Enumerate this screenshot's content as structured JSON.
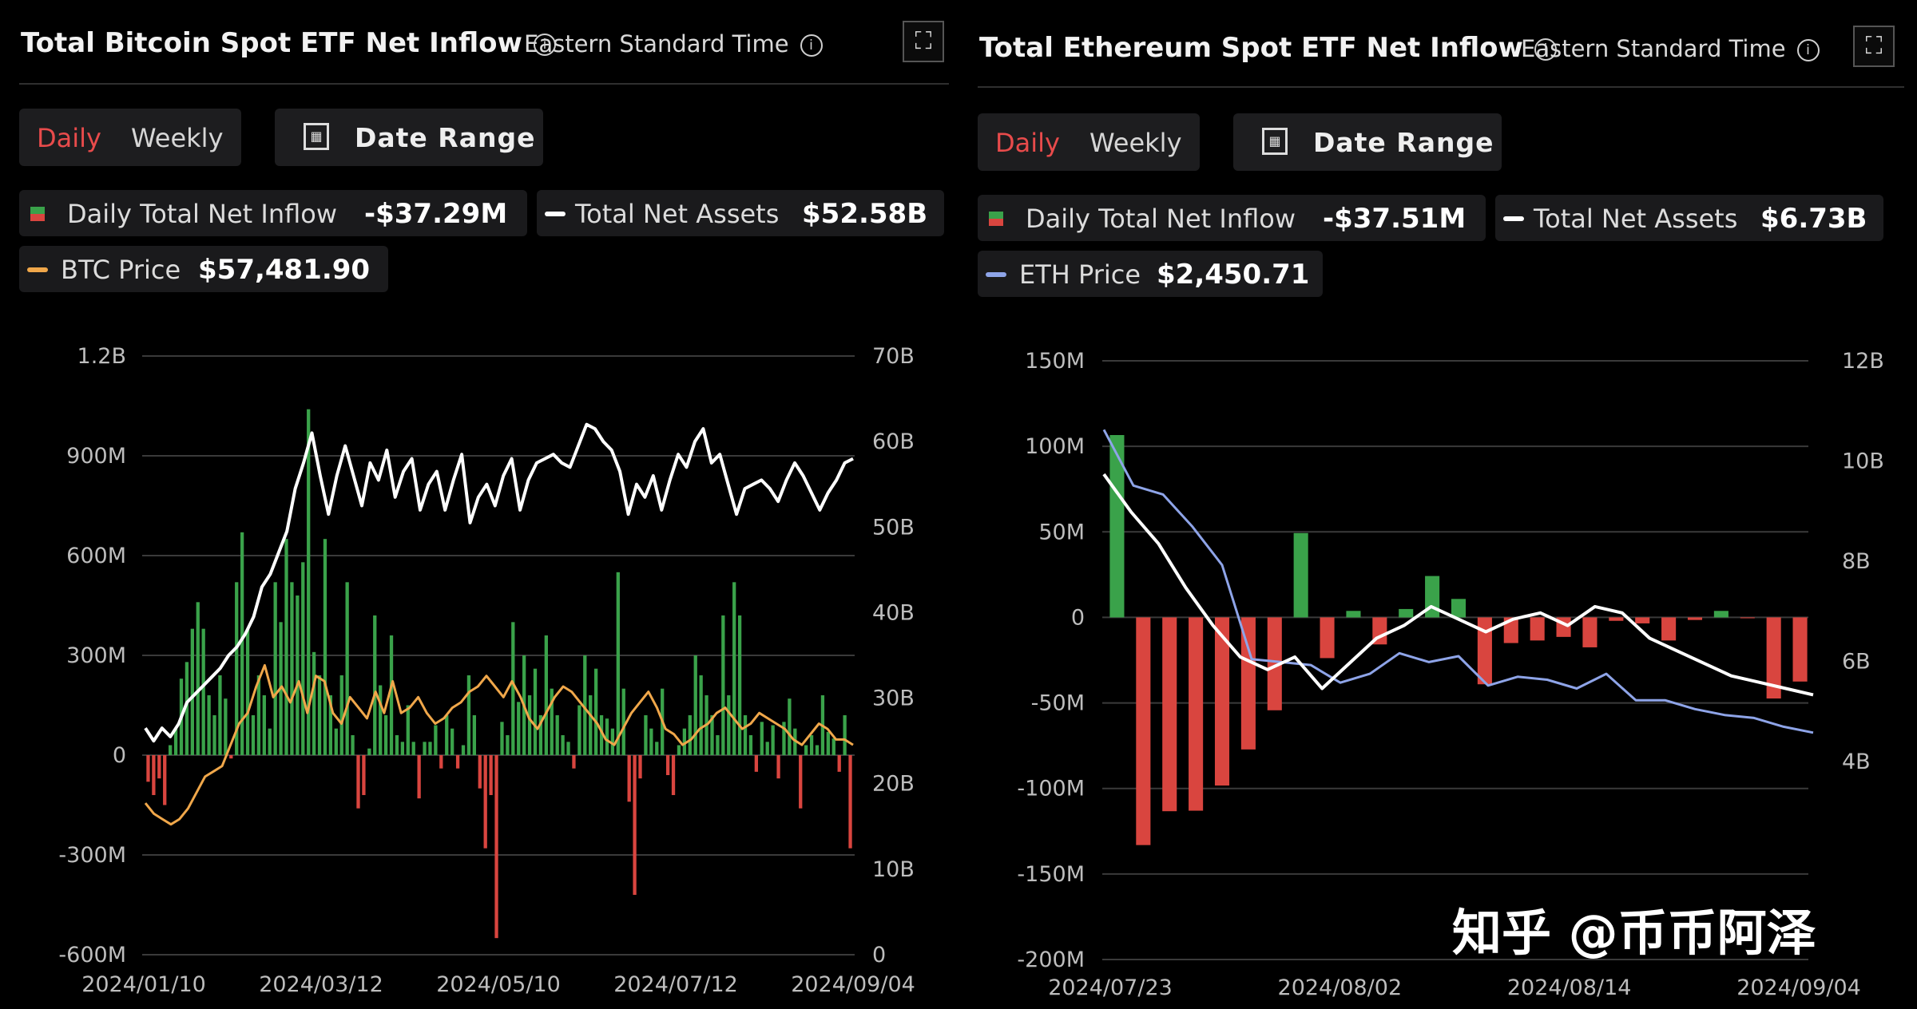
{
  "panels": {
    "btc": {
      "title": "Total Bitcoin Spot ETF Net Inflow",
      "timezone": "Eastern Standard Time",
      "tabs": {
        "daily": "Daily",
        "weekly": "Weekly",
        "active": "Daily"
      },
      "date_range_label": "Date Range",
      "legend": {
        "flow_label": "Daily Total Net Inflow",
        "flow_value": "-$37.29M",
        "assets_label": "Total Net Assets",
        "assets_value": "$52.58B",
        "price_label": "BTC Price",
        "price_value": "$57,481.90"
      }
    },
    "eth": {
      "title": "Total Ethereum Spot ETF Net Inflow",
      "timezone": "Eastern Standard Time",
      "tabs": {
        "daily": "Daily",
        "weekly": "Weekly",
        "active": "Daily"
      },
      "date_range_label": "Date Range",
      "legend": {
        "flow_label": "Daily Total Net Inflow",
        "flow_value": "-$37.51M",
        "assets_label": "Total Net Assets",
        "assets_value": "$6.73B",
        "price_label": "ETH Price",
        "price_value": "$2,450.71"
      }
    }
  },
  "icons": {
    "info": "info-icon",
    "fullscreen": "fullscreen-icon",
    "calendar": "calendar-icon"
  },
  "colors": {
    "inflow": "#3aa24a",
    "outflow": "#d9453f",
    "total_assets_line": "#ffffff",
    "btc_price_line": "#f0a74a",
    "eth_price_line": "#8ea4e8",
    "active_tab": "#e84b4b"
  },
  "watermark": "知乎 @币币阿泽",
  "chart_data": [
    {
      "type": "bar",
      "name": "btc",
      "x_ticks": [
        "2024/01/10",
        "2024/03/12",
        "2024/05/10",
        "2024/07/12",
        "2024/09/04"
      ],
      "y_left_ticks": [
        "1.2B",
        "900M",
        "600M",
        "300M",
        "0",
        "-300M",
        "-600M"
      ],
      "y_left_range": [
        -600,
        1200
      ],
      "y_right_ticks": [
        "70B",
        "60B",
        "50B",
        "40B",
        "30B",
        "20B",
        "10B",
        "0"
      ],
      "y_right_range": [
        0,
        70
      ],
      "grid": true,
      "flows_musd": [
        -80,
        -120,
        -70,
        -150,
        30,
        80,
        230,
        280,
        380,
        460,
        380,
        180,
        120,
        240,
        170,
        -10,
        520,
        670,
        380,
        120,
        240,
        180,
        80,
        520,
        400,
        650,
        520,
        480,
        580,
        1040,
        310,
        240,
        650,
        180,
        80,
        240,
        520,
        60,
        -160,
        -120,
        20,
        420,
        210,
        120,
        360,
        60,
        40,
        150,
        40,
        -130,
        40,
        40,
        90,
        -40,
        120,
        80,
        -40,
        30,
        240,
        120,
        -100,
        -280,
        -120,
        -550,
        100,
        60,
        400,
        160,
        300,
        180,
        260,
        120,
        360,
        200,
        120,
        60,
        40,
        -40,
        150,
        300,
        180,
        260,
        120,
        110,
        80,
        550,
        200,
        -140,
        -420,
        -70,
        120,
        80,
        40,
        200,
        -60,
        -120,
        30,
        80,
        120,
        300,
        240,
        180,
        120,
        60,
        420,
        180,
        520,
        420,
        120,
        60,
        -50,
        100,
        40,
        90,
        -70,
        100,
        170,
        80,
        -160,
        30,
        60,
        30,
        180,
        70,
        50,
        -50,
        120,
        -280
      ],
      "total_net_assets_b": [
        26.5,
        25.0,
        26.5,
        25.5,
        27,
        29.5,
        30.5,
        31.5,
        32.5,
        33.5,
        35,
        36,
        37.5,
        39.5,
        43,
        44.5,
        47,
        49.5,
        54.5,
        57.5,
        61,
        56,
        51.5,
        56.0,
        59.5,
        56.0,
        52.5,
        57.5,
        55.5,
        59.0,
        53.5,
        56.5,
        58.0,
        52.0,
        55.0,
        56.5,
        52.0,
        55.5,
        58.5,
        50.5,
        53.5,
        55.0,
        52.5,
        56.0,
        58.0,
        52.0,
        55.5,
        57.5,
        58.0,
        58.5,
        57.5,
        57.0,
        59.5,
        62.0,
        61.5,
        60.0,
        59.0,
        56.5,
        51.5,
        55.0,
        53.5,
        56.0,
        52.0,
        55.5,
        58.5,
        57.0,
        60.0,
        61.5,
        57.5,
        58.5,
        55.0,
        51.5,
        54.5,
        55.0,
        55.5,
        54.5,
        53.0,
        55.5,
        57.5,
        56.0,
        54.0,
        52.0,
        54.0,
        55.5,
        57.5,
        58.0
      ],
      "btc_price_k": [
        46,
        44,
        43,
        42,
        43,
        45,
        48,
        51,
        52,
        53,
        57,
        61,
        63,
        68,
        72,
        66,
        68,
        65,
        69,
        63,
        70,
        69,
        63,
        61,
        66,
        64,
        62,
        67,
        63,
        69,
        63,
        64,
        66,
        63,
        61,
        62,
        64,
        65,
        67,
        68,
        70,
        68,
        66,
        69,
        66,
        62,
        60,
        63,
        66,
        68,
        67,
        65,
        63,
        61,
        58,
        57,
        60,
        63,
        65,
        67,
        64,
        60,
        59,
        57,
        58,
        60,
        61,
        63,
        64,
        62,
        60,
        61,
        63,
        62,
        61,
        60,
        58,
        57,
        59,
        61,
        60,
        58,
        58,
        57
      ],
      "series": [
        {
          "name": "Daily Total Net Inflow",
          "kind": "bar"
        },
        {
          "name": "Total Net Assets",
          "kind": "line"
        },
        {
          "name": "BTC Price",
          "kind": "line"
        }
      ]
    },
    {
      "type": "bar",
      "name": "eth",
      "x_ticks": [
        "2024/07/23",
        "2024/08/02",
        "2024/08/14",
        "2024/09/04"
      ],
      "y_left_ticks": [
        "150M",
        "100M",
        "50M",
        "0",
        "-50M",
        "-100M",
        "-150M",
        "-200M"
      ],
      "y_left_range": [
        -200,
        150
      ],
      "y_right_ticks": [
        "12B",
        "10B",
        "8B",
        "6B",
        "4B"
      ],
      "y_right_range": [
        2.5,
        12
      ],
      "grid": true,
      "flows_musd": [
        106.6,
        -133.1,
        -113.3,
        -113.0,
        -98.3,
        -77.2,
        -54.3,
        49.3,
        -23.8,
        3.8,
        -15.8,
        4.9,
        24.2,
        10.8,
        -39.1,
        -15.0,
        -13.5,
        -11.4,
        -17.5,
        -2.0,
        -3.5,
        -13.5,
        -1.5,
        3.8,
        -0.5,
        -47.4,
        -37.5
      ],
      "total_net_assets_b": [
        10.2,
        9.6,
        9.1,
        8.4,
        7.8,
        7.3,
        7.1,
        7.3,
        6.8,
        7.2,
        7.6,
        7.8,
        8.1,
        7.9,
        7.7,
        7.9,
        8.0,
        7.8,
        8.1,
        8.0,
        7.6,
        7.4,
        7.2,
        7.0,
        6.9,
        6.8,
        6.7
      ],
      "eth_price_usd": [
        3480,
        3290,
        3260,
        3150,
        3020,
        2700,
        2690,
        2680,
        2620,
        2650,
        2720,
        2690,
        2710,
        2610,
        2640,
        2630,
        2600,
        2650,
        2560,
        2560,
        2530,
        2510,
        2500,
        2470,
        2450
      ],
      "series": [
        {
          "name": "Daily Total Net Inflow",
          "kind": "bar"
        },
        {
          "name": "Total Net Assets",
          "kind": "line"
        },
        {
          "name": "ETH Price",
          "kind": "line"
        }
      ]
    }
  ]
}
